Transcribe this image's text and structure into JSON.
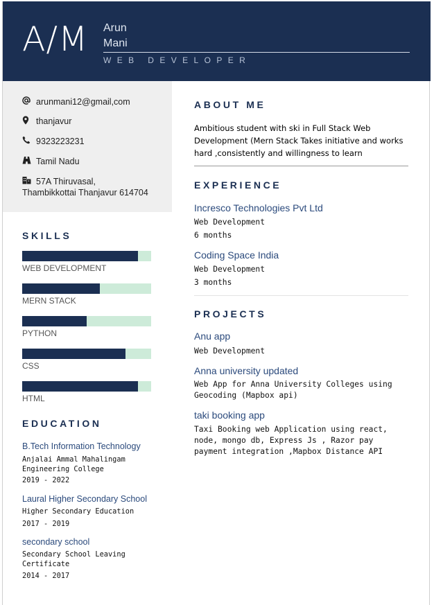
{
  "header": {
    "monogram": "A/M",
    "first_name": "Arun",
    "last_name": "Mani",
    "job_title": "WEB DEVELOPER"
  },
  "contact": {
    "email": "arunmani12@gmail,com",
    "city": "thanjavur",
    "phone": "9323223231",
    "state": "Tamil Nadu",
    "address_line1": "57A Thiruvasal,",
    "address_line2": "Thambikkottai Thanjavur 614704"
  },
  "skills": {
    "title": "SKILLS",
    "items": [
      {
        "label": "WEB DEVELOPMENT",
        "level": 0.9
      },
      {
        "label": "MERN STACK",
        "level": 0.6
      },
      {
        "label": "PYTHON",
        "level": 0.5
      },
      {
        "label": "CSS",
        "level": 0.8
      },
      {
        "label": "HTML",
        "level": 0.9
      }
    ]
  },
  "education": {
    "title": "EDUCATION",
    "items": [
      {
        "degree": "B.Tech Information Technology",
        "institution": "Anjalai Ammal Mahalingam Engineering College",
        "years": "2019 - 2022"
      },
      {
        "degree": "Laural Higher Secondary School",
        "institution": "Higher Secondary Education",
        "years": "2017 - 2019"
      },
      {
        "degree": "secondary school",
        "institution": "Secondary School Leaving Certificate",
        "years": "2014 - 2017"
      }
    ]
  },
  "about": {
    "title": "ABOUT ME",
    "text": "Ambitious student with ski in Full Stack Web Development (Mern Stack Takes initiative and works hard ,consistently and willingness to learn"
  },
  "experience": {
    "title": "EXPERIENCE",
    "items": [
      {
        "company": "Incresco Technologies Pvt Ltd",
        "role": "Web Development",
        "duration": "6 months"
      },
      {
        "company": "Coding Space India",
        "role": "Web Development",
        "duration": "3 months"
      }
    ]
  },
  "projects": {
    "title": "PROJECTS",
    "items": [
      {
        "name": "Anu app",
        "description": "Web Development"
      },
      {
        "name": "Anna university updated",
        "description": "Web App for Anna University Colleges using Geocoding (Mapbox api)"
      },
      {
        "name": "taki booking app",
        "description": "Taxi Booking web Application using react, node, mongo db, Express Js , Razor pay payment integration ,Mapbox Distance API"
      }
    ]
  },
  "colors": {
    "navy": "#1b2f52",
    "skill_track": "#cdebd9",
    "heading_blue": "#2b4a7c",
    "contact_bg": "#efefef"
  },
  "icons": {
    "email": "at-icon",
    "city": "map-pin-icon",
    "phone": "phone-icon",
    "state": "map-icon",
    "address": "building-icon"
  }
}
